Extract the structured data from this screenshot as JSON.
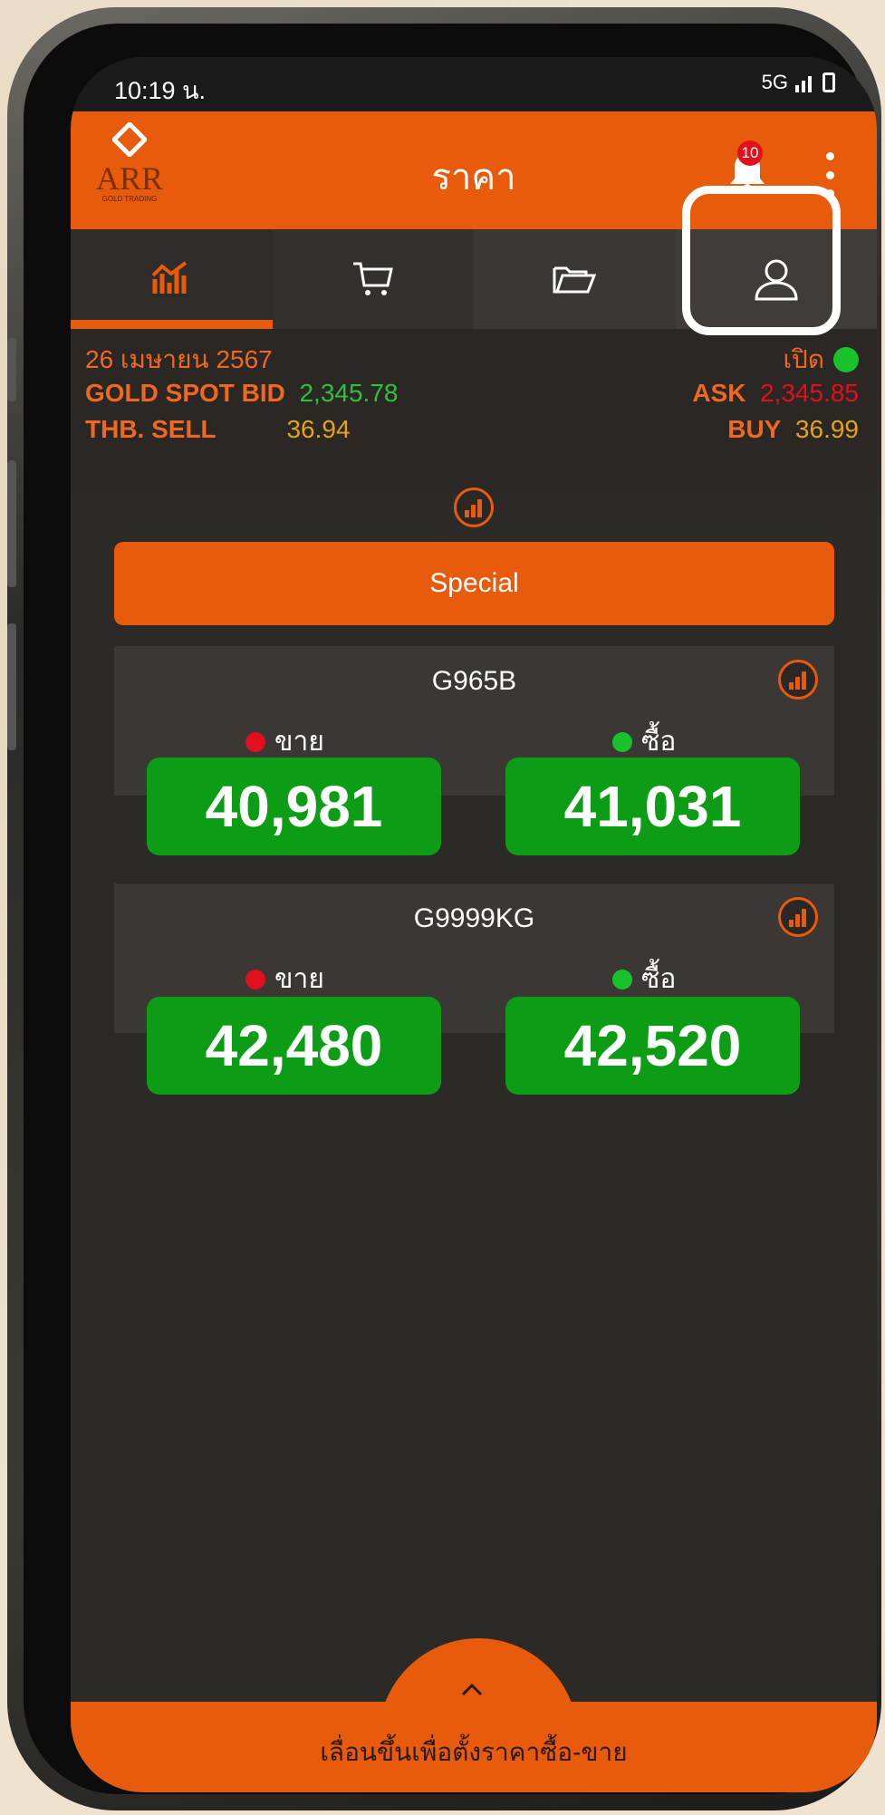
{
  "status_bar": {
    "time": "10:19 น.",
    "network": "5G"
  },
  "app_bar": {
    "logo_text": "ARR",
    "logo_sub": "GOLD TRADING",
    "title": "ราคา",
    "notification_count": "10"
  },
  "tabs": [
    {
      "icon": "price-chart-icon",
      "active": true
    },
    {
      "icon": "cart-icon",
      "active": false
    },
    {
      "icon": "folder-icon",
      "active": false
    },
    {
      "icon": "user-icon",
      "active": false
    }
  ],
  "market": {
    "date": "26 เมษายน 2567",
    "status": "เปิด",
    "gold_spot_bid_label": "GOLD SPOT BID",
    "gold_spot_bid": "2,345.78",
    "ask_label": "ASK",
    "ask": "2,345.85",
    "thb_sell_label": "THB. SELL",
    "thb_sell": "36.94",
    "buy_label": "BUY",
    "buy": "36.99"
  },
  "special_label": "Special",
  "products": [
    {
      "name": "G965B",
      "sell_label": "ขาย",
      "buy_label": "ซื้อ",
      "sell": "40,981",
      "buy": "41,031"
    },
    {
      "name": "G9999KG",
      "sell_label": "ขาย",
      "buy_label": "ซื้อ",
      "sell": "42,480",
      "buy": "42,520"
    }
  ],
  "bottom_hint": "เลื่อนขึ้นเพื่อตั้งราคาซื้อ-ขาย",
  "colors": {
    "accent": "#e85a0c",
    "price_bg": "#0d9c16",
    "bid_green": "#2ec23a",
    "ask_red": "#e0101c",
    "thb_gold": "#e6a21a"
  }
}
